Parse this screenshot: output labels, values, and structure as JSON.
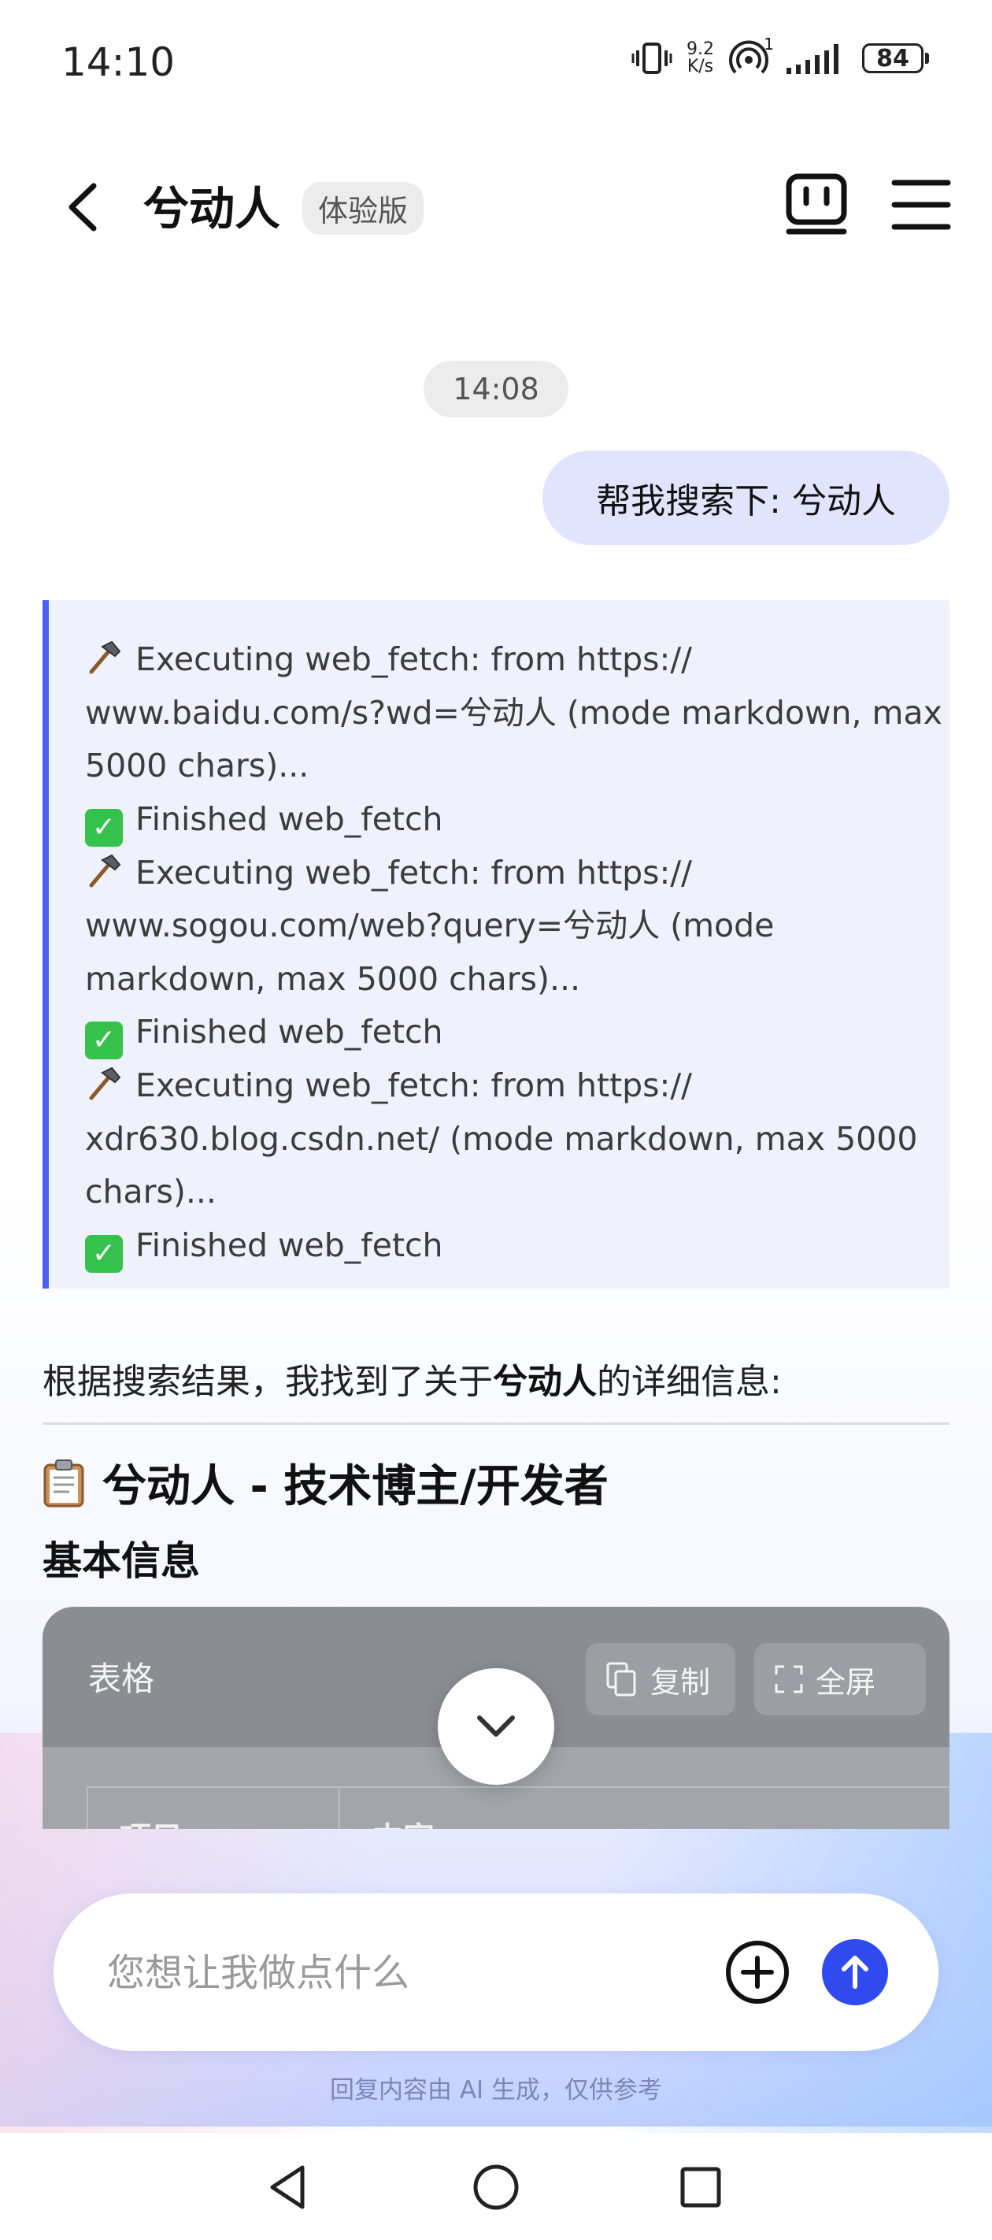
{
  "status_bar": {
    "time": "14:10",
    "net_speed_value": "9.2",
    "net_speed_unit": "K/s",
    "hotspot_count": "1",
    "battery": "84"
  },
  "header": {
    "title": "兮动人",
    "badge": "体验版"
  },
  "chat": {
    "timestamp": "14:08",
    "user_message": "帮我搜索下: 兮动人",
    "tool_log": [
      {
        "icon": "hammer-icon",
        "text": "Executing web_fetch: from https://"
      },
      {
        "icon": "",
        "text": "www.baidu.com/s?wd=兮动人 (mode markdown, max"
      },
      {
        "icon": "",
        "text": "5000 chars)..."
      },
      {
        "icon": "check-icon",
        "text": "Finished web_fetch"
      },
      {
        "icon": "hammer-icon",
        "text": "Executing web_fetch: from https://"
      },
      {
        "icon": "",
        "text": "www.sogou.com/web?query=兮动人 (mode"
      },
      {
        "icon": "",
        "text": "markdown, max 5000 chars)..."
      },
      {
        "icon": "check-icon",
        "text": "Finished web_fetch"
      },
      {
        "icon": "hammer-icon",
        "text": "Executing web_fetch: from https://"
      },
      {
        "icon": "",
        "text": "xdr630.blog.csdn.net/ (mode markdown, max 5000"
      },
      {
        "icon": "",
        "text": "chars)..."
      },
      {
        "icon": "check-icon",
        "text": "Finished web_fetch"
      }
    ],
    "result_intro_before": "根据搜索结果，我找到了关于",
    "result_intro_bold": "兮动人",
    "result_intro_after": "的详细信息:",
    "section_title": "兮动人 - 技术博主/开发者",
    "subheading": "基本信息",
    "table": {
      "label": "表格",
      "copy_label": "复制",
      "fullscreen_label": "全屏",
      "headers": [
        "项目",
        "内容"
      ]
    }
  },
  "input": {
    "placeholder": "您想让我做点什么"
  },
  "disclaimer": "回复内容由 AI 生成，仅供参考",
  "colors": {
    "accent": "#2f4bf0",
    "tool_border": "#4e5ff0",
    "tool_bg": "#eff1fd",
    "user_bubble": "#e2e4fd",
    "check_green": "#34c14c"
  }
}
